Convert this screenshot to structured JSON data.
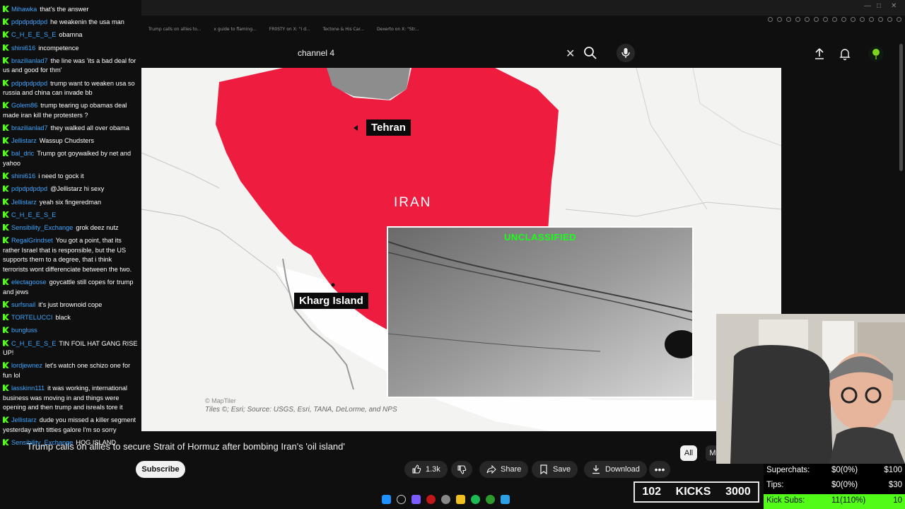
{
  "search": {
    "query": "channel 4"
  },
  "video": {
    "title": "Trump calls on allies to secure Strait of Hormuz after bombing Iran's 'oil island'",
    "map_labels": {
      "tehran": "Tehran",
      "iran": "IRAN",
      "kharg": "Kharg Island"
    },
    "inset_tag": "UNCLASSIFIED",
    "credit_maptiler": "© MapTiler",
    "credit_tiles": "Tiles ©; Esri; Source: USGS, Esri, TANA, DeLorme, and NPS"
  },
  "actions": {
    "subscribe": "Subscribe",
    "likes": "1.3k",
    "share": "Share",
    "save": "Save",
    "download": "Download"
  },
  "chips": {
    "all": "All",
    "m": "M"
  },
  "chat": [
    {
      "user": "Mihawka",
      "text": "that's the answer"
    },
    {
      "user": "pdpdpdpdpd",
      "text": "he weakenin the usa man"
    },
    {
      "user": "C_H_E_E_S_E",
      "text": "obamna"
    },
    {
      "user": "shini616",
      "text": "incompetence"
    },
    {
      "user": "brazilianlad7",
      "text": "the line was 'its a bad deal for us and good for thm'"
    },
    {
      "user": "pdpdpdpdpd",
      "text": "trump want to weaken usa so russia and china can invade bb"
    },
    {
      "user": "Golem86",
      "text": "trump tearing up obamas deal made iran kill the protesters ?"
    },
    {
      "user": "brazilianlad7",
      "text": "they walked all over obama"
    },
    {
      "user": "Jellistarz",
      "text": "Wassup Chudsters"
    },
    {
      "user": "bal_dric",
      "text": "Trump got goywalked by net and yahoo"
    },
    {
      "user": "shini616",
      "text": "i need to gock it"
    },
    {
      "user": "pdpdpdpdpd",
      "text": "@Jellistarz hi sexy"
    },
    {
      "user": "Jellistarz",
      "text": "yeah six fingeredman"
    },
    {
      "user": "C_H_E_E_S_E",
      "text": ""
    },
    {
      "user": "Sensibility_Exchange",
      "text": "grok deez nutz"
    },
    {
      "user": "RegalGrindset",
      "text": "You got a point, that its rather Israel that is responsible, but the US supports them to a degree, that i think terrorists wont differenciate between the two."
    },
    {
      "user": "electagoose",
      "text": "goycattle still copes for trump and jews"
    },
    {
      "user": "surfsnail",
      "text": "it's just brownoid cope"
    },
    {
      "user": "TORTELUCCI",
      "text": "black"
    },
    {
      "user": "bungluss",
      "text": ""
    },
    {
      "user": "C_H_E_E_S_E",
      "text": "TIN FOIL HAT GANG RISE UP!"
    },
    {
      "user": "lordjewnez",
      "text": "let's watch one schizo one for fun lol"
    },
    {
      "user": "lasskinn111",
      "text": "it was working, international business was moving in and things were opening and then trump and isreals tore it"
    },
    {
      "user": "Jellistarz",
      "text": "dude you missed a killer segment yesterday with titties galore I'm so sorry"
    },
    {
      "user": "Sensibility_Exchange",
      "text": "HOG ISLAND"
    }
  ],
  "stats": {
    "superchats": {
      "label": "Superchats:",
      "value": "$0(0%)",
      "goal": "$100"
    },
    "tips": {
      "label": "Tips:",
      "value": "$0(0%)",
      "goal": "$30"
    },
    "kick_subs": {
      "label": "Kick Subs:",
      "value": "11(110%)",
      "goal": "10"
    },
    "kicks": {
      "count": "102",
      "label": "KICKS",
      "goal": "3000"
    }
  },
  "bookmarks": [
    "Trump calls on allies to...",
    "x guide to flaming...",
    "FR0STY on X: \"I d...",
    "Tectone & His Car...",
    "Dexerto on X: \"Str..."
  ],
  "colors": {
    "iran_red": "#ee1c3f",
    "kick_green": "#53fc18",
    "link_blue": "#3ea6ff",
    "unclassified_green": "#18ff18"
  }
}
